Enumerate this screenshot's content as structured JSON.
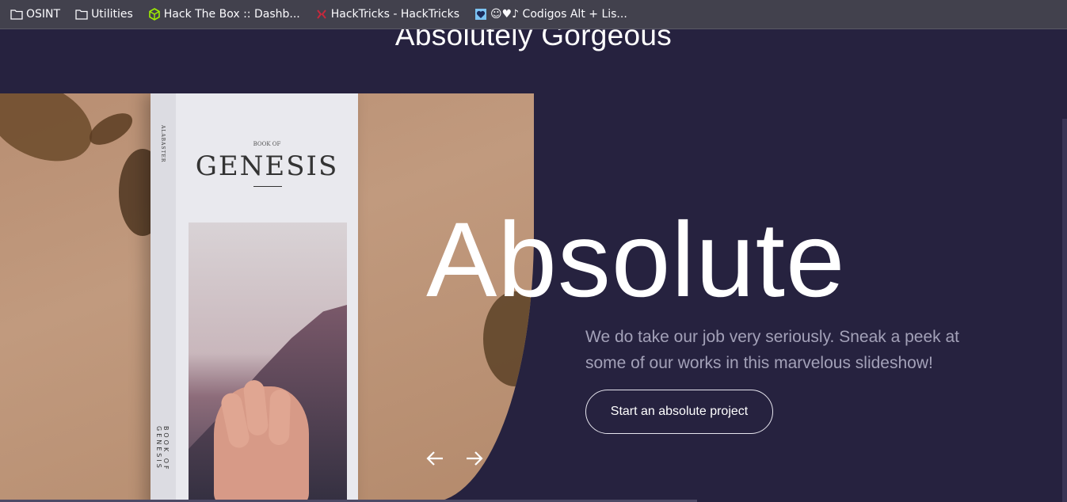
{
  "bookmarks": [
    {
      "label": "OSINT",
      "icon": "folder-icon"
    },
    {
      "label": "Utilities",
      "icon": "folder-icon"
    },
    {
      "label": "Hack The Box :: Dashb...",
      "icon": "htb-cube-icon"
    },
    {
      "label": "HackTricks - HackTricks",
      "icon": "hacktricks-icon"
    },
    {
      "label": "☺♥♪ Codigos Alt + Lis...",
      "icon": "heart-card-icon"
    }
  ],
  "section": {
    "title": "Absolutely Gorgeous"
  },
  "hero": {
    "headline": "Absolute",
    "description": "We do take our job very seriously. Sneak a peek at some of our works in this marvelous slideshow!",
    "cta_label": "Start an absolute project"
  },
  "book": {
    "book_of": "BOOK OF",
    "title": "GENESIS",
    "spine_text": "BOOK OF GENESIS",
    "publisher": "ALABASTER"
  },
  "colors": {
    "page_bg": "#26223f",
    "bookmark_bar": "#42414d",
    "desc_text": "#a3a1b8"
  }
}
